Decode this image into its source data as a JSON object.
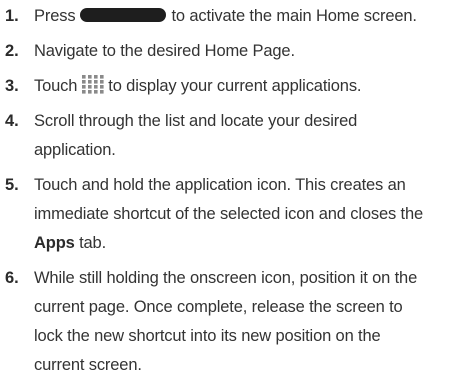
{
  "steps": [
    {
      "number": "1.",
      "before_icon": "Press",
      "icon": "home-key-icon",
      "after_icon": "to activate the main Home screen."
    },
    {
      "number": "2.",
      "text": "Navigate to the desired Home Page."
    },
    {
      "number": "3.",
      "before_icon": "Touch",
      "icon": "apps-grid-icon",
      "after_icon": "to display your current applications."
    },
    {
      "number": "4.",
      "line1": "Scroll through the list and locate your desired",
      "line2": "application."
    },
    {
      "number": "5.",
      "line1": "Touch and hold the application icon. This creates an",
      "line2": "immediate shortcut of the selected icon and closes the",
      "line3_bold": "Apps",
      "line3_rest": "tab."
    },
    {
      "number": "6.",
      "line1": "While still holding the onscreen icon, position it on the",
      "line2": "current page. Once complete, release the screen to",
      "line3": "lock the new shortcut into its new position on the",
      "line4": "current screen."
    }
  ],
  "colors": {
    "text": "#333333",
    "number": "#2b2b2b",
    "home_key": "#1e1e1e",
    "grid_dots": "#8a8a8a"
  }
}
